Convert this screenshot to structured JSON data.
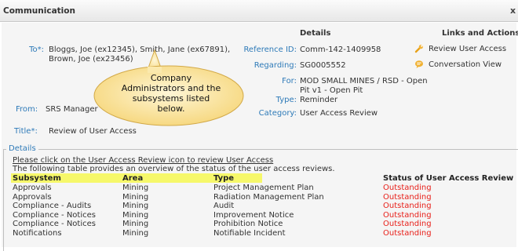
{
  "window": {
    "title": "Communication",
    "close_label": "x"
  },
  "columns": {
    "details": "Details",
    "links": "Links and Actions"
  },
  "fields": {
    "to_label": "To",
    "to_value_line1": "Bloggs, Joe (ex12345), Smith, Jane (ex67891),",
    "to_value_line2": "Brown, Joe (ex23456)",
    "from_label": "From:",
    "from_value": "SRS Manager",
    "title_label": "Title",
    "title_value": "Review of User Access",
    "required_mark": "*:",
    "reference_label": "Reference ID:",
    "reference_value": "Comm-142-1409958",
    "regarding_label": "Regarding:",
    "regarding_value": "SG0005552",
    "for_label": "For:",
    "for_value_line1": "MOD SMALL MINES / RSD - Open",
    "for_value_line2": "Pit v1 - Open Pit",
    "type_label": "Type:",
    "type_value": "Reminder",
    "category_label": "Category:",
    "category_value": "User Access Review"
  },
  "links": [
    {
      "label": "Review User Access",
      "icon": "wrench-icon"
    },
    {
      "label": "Conversation View",
      "icon": "chat-bubble-icon"
    }
  ],
  "callout": {
    "line1": "Company",
    "line2": "Administrators and the",
    "line3": "subsystems listed",
    "line4": "below."
  },
  "details_section": {
    "legend": "Details",
    "link_text": "Please click on the User Access Review icon to review User Access",
    "intro_text": "The following table provides an overview of the status of the user access reviews."
  },
  "table": {
    "headers": {
      "subsystem": "Subsystem",
      "area": "Area",
      "type": "Type",
      "status": "Status of User Access Review"
    },
    "rows": [
      {
        "subsystem": "Approvals",
        "area": "Mining",
        "type": "Project Management Plan",
        "status": "Outstanding"
      },
      {
        "subsystem": "Approvals",
        "area": "Mining",
        "type": "Radiation Management Plan",
        "status": "Outstanding"
      },
      {
        "subsystem": "Compliance - Audits",
        "area": "Mining",
        "type": "Audit",
        "status": "Outstanding"
      },
      {
        "subsystem": "Compliance - Notices",
        "area": "Mining",
        "type": "Improvement Notice",
        "status": "Outstanding"
      },
      {
        "subsystem": "Compliance - Notices",
        "area": "Mining",
        "type": "Prohibition Notice",
        "status": "Outstanding"
      },
      {
        "subsystem": "Notifications",
        "area": "Mining",
        "type": "Notifiable Incident",
        "status": "Outstanding"
      }
    ]
  },
  "colors": {
    "label_blue": "#2e7ab8",
    "status_red": "#e8201a",
    "highlight_yellow": "#f6f86a",
    "callout_fill": "#fde9a8"
  }
}
